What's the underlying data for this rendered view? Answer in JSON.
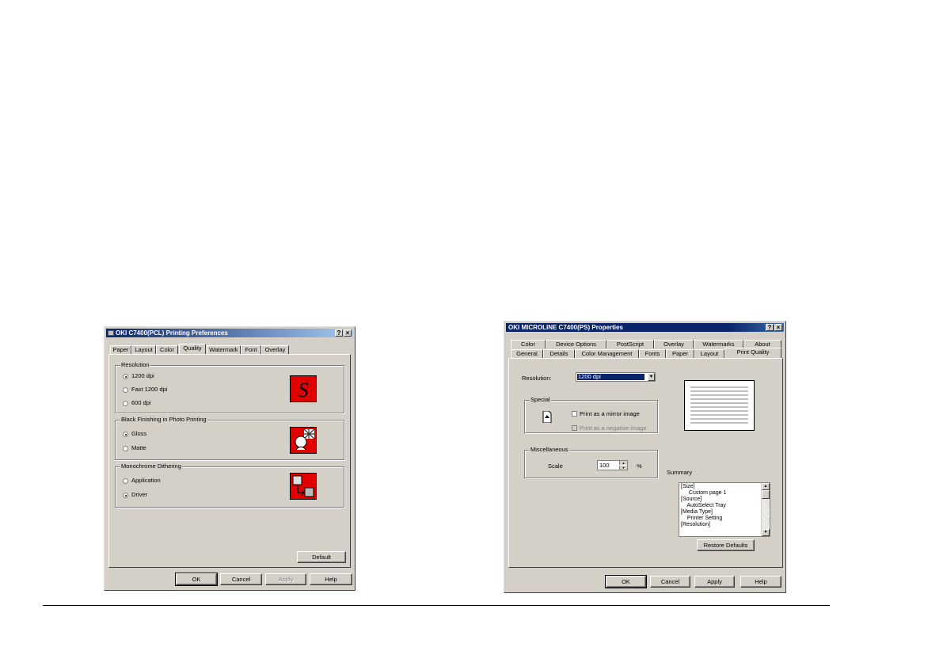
{
  "left_dialog": {
    "title": "OKI C7400(PCL) Printing Preferences",
    "title_help": "?",
    "title_close": "×",
    "tabs": [
      "Paper",
      "Layout",
      "Color",
      "Quality",
      "Watermark",
      "Font",
      "Overlay"
    ],
    "selected_tab": "Quality",
    "resolution": {
      "label": "Resolution",
      "options": [
        "1200 dpi",
        "Fast 1200 dpi",
        "600 dpi"
      ],
      "selected": "1200 dpi"
    },
    "black_finishing": {
      "label": "Black Finishing in Photo Printing",
      "options": [
        "Gloss",
        "Matte"
      ],
      "selected": "Gloss"
    },
    "monochrome": {
      "label": "Monochrome Dithering",
      "options": [
        "Application",
        "Driver"
      ],
      "selected": "Driver"
    },
    "default_button": "Default",
    "buttons": {
      "ok": "OK",
      "cancel": "Cancel",
      "apply": "Apply",
      "help": "Help"
    }
  },
  "right_dialog": {
    "title": "OKI MICROLINE C7400(PS) Properties",
    "title_help": "?",
    "title_close": "×",
    "tabs_back": [
      "Color",
      "Device Options",
      "PostScript",
      "Overlay",
      "Watermarks",
      "About"
    ],
    "tabs_front": [
      "General",
      "Details",
      "Color Management",
      "Fonts",
      "Paper",
      "Layout",
      "Print Quality"
    ],
    "selected_tab": "Print Quality",
    "resolution_label": "Resolution:",
    "resolution_value": "1200 dpi",
    "special": {
      "label": "Special",
      "mirror": "Print as a mirror image",
      "negative": "Print as a negative image"
    },
    "misc": {
      "label": "Miscellaneous",
      "scale_label": "Scale",
      "scale_value": "100",
      "scale_unit": "%"
    },
    "summary_label": "Summary",
    "summary_lines": [
      "[Size]",
      "  Custom page 1",
      "[Source]",
      "  AutoSelect Tray",
      "[Media Type]",
      "  Printer Setting",
      "[Resolution]"
    ],
    "restore_defaults": "Restore Defaults",
    "buttons": {
      "ok": "OK",
      "cancel": "Cancel",
      "apply": "Apply",
      "help": "Help"
    }
  }
}
